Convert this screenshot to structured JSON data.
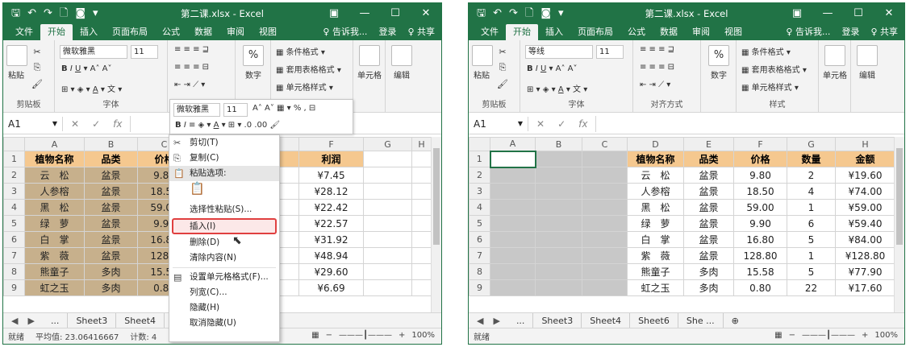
{
  "window1": {
    "title": "第二课.xlsx - Excel",
    "tabs": [
      "文件",
      "开始",
      "插入",
      "页面布局",
      "公式",
      "数据",
      "审阅",
      "视图"
    ],
    "tellme": "♀ 告诉我...",
    "login": "登录",
    "share": "♀ 共享",
    "font_name": "微软雅黑",
    "font_size": "11",
    "clipboard_label": "剪贴板",
    "paste_label": "粘贴",
    "font_label": "字体",
    "number_label": "数字",
    "percent": "%",
    "cond_format": "条件格式",
    "table_format": "套用表格格式",
    "cell_styles": "单元格样式",
    "cells_label": "单元格",
    "edit_label": "编辑",
    "namebox": "A1",
    "columns": [
      "A",
      "B",
      "C",
      "D",
      "E",
      "F",
      "G",
      "H"
    ],
    "rows": [
      "1",
      "2",
      "3",
      "4",
      "5",
      "6",
      "7",
      "8",
      "9"
    ],
    "headers": [
      "植物名称",
      "品类",
      "价格",
      "",
      "",
      "利润"
    ],
    "data": [
      [
        "云　松",
        "盆景",
        "9.80",
        "¥7.45"
      ],
      [
        "人参榕",
        "盆景",
        "18.50",
        "¥28.12"
      ],
      [
        "黑　松",
        "盆景",
        "59.00",
        "¥22.42"
      ],
      [
        "绿　萝",
        "盆景",
        "9.90",
        "¥22.57"
      ],
      [
        "白　掌",
        "盆景",
        "16.80",
        "¥31.92"
      ],
      [
        "紫　薇",
        "盆景",
        "128.8",
        "¥48.94"
      ],
      [
        "熊童子",
        "多肉",
        "15.58",
        "¥29.60"
      ],
      [
        "虹之玉",
        "多肉",
        "0.80",
        "¥6.69"
      ]
    ],
    "sheets": [
      "...",
      "Sheet3",
      "Sheet4"
    ],
    "status": [
      "就绪",
      "平均值: 23.06416667",
      "计数: 4"
    ],
    "zoom": "100%",
    "mini_toolbar": {
      "font": "微软雅黑",
      "size": "11"
    },
    "context_menu": [
      "剪切(T)",
      "复制(C)",
      "粘贴选项:",
      "",
      "选择性粘贴(S)...",
      "插入(I)",
      "删除(D)",
      "清除内容(N)",
      "设置单元格格式(F)...",
      "列宽(C)...",
      "隐藏(H)",
      "取消隐藏(U)"
    ]
  },
  "window2": {
    "title": "第二课.xlsx - Excel",
    "tabs": [
      "文件",
      "开始",
      "插入",
      "页面布局",
      "公式",
      "数据",
      "审阅",
      "视图"
    ],
    "tellme": "♀ 告诉我...",
    "login": "登录",
    "share": "♀ 共享",
    "font_name": "等线",
    "font_size": "11",
    "clipboard_label": "剪贴板",
    "paste_label": "粘贴",
    "font_label": "字体",
    "align_label": "对齐方式",
    "number_label": "数字",
    "percent": "%",
    "cond_format": "条件格式",
    "table_format": "套用表格格式",
    "cell_styles": "单元格样式",
    "styles_label": "样式",
    "cells_label": "单元格",
    "edit_label": "编辑",
    "namebox": "A1",
    "columns": [
      "A",
      "B",
      "C",
      "D",
      "E",
      "F",
      "G",
      "H"
    ],
    "rows": [
      "1",
      "2",
      "3",
      "4",
      "5",
      "6",
      "7",
      "8",
      "9"
    ],
    "headers": [
      "植物名称",
      "品类",
      "价格",
      "数量",
      "金额"
    ],
    "data": [
      [
        "云　松",
        "盆景",
        "9.80",
        "2",
        "¥19.60"
      ],
      [
        "人参榕",
        "盆景",
        "18.50",
        "4",
        "¥74.00"
      ],
      [
        "黑　松",
        "盆景",
        "59.00",
        "1",
        "¥59.00"
      ],
      [
        "绿　萝",
        "盆景",
        "9.90",
        "6",
        "¥59.40"
      ],
      [
        "白　掌",
        "盆景",
        "16.80",
        "5",
        "¥84.00"
      ],
      [
        "紫　薇",
        "盆景",
        "128.80",
        "1",
        "¥128.80"
      ],
      [
        "熊童子",
        "多肉",
        "15.58",
        "5",
        "¥77.90"
      ],
      [
        "虹之玉",
        "多肉",
        "0.80",
        "22",
        "¥17.60"
      ]
    ],
    "sheets": [
      "...",
      "Sheet3",
      "Sheet4",
      "Sheet6",
      "She ..."
    ],
    "status": [
      "就绪"
    ],
    "zoom": "100%"
  }
}
